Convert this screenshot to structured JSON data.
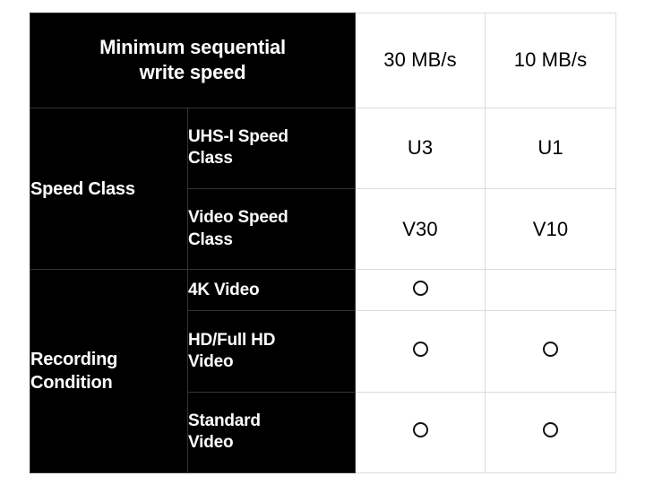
{
  "table": {
    "header": {
      "title": "Minimum sequential\nwrite speed",
      "title_line1": "Minimum sequential",
      "title_line2": "write speed",
      "columns": [
        "30 MB/s",
        "10 MB/s"
      ]
    },
    "groups": [
      {
        "label": "Speed Class",
        "rows": [
          {
            "label_line1": "UHS-I Speed",
            "label_line2": "Class",
            "values": [
              "U3",
              "U1"
            ],
            "value_kind": "text"
          },
          {
            "label_line1": "Video Speed",
            "label_line2": "Class",
            "values": [
              "V30",
              "V10"
            ],
            "value_kind": "text"
          }
        ]
      },
      {
        "label_line1": "Recording",
        "label_line2": "Condition",
        "label": "Recording Condition",
        "rows": [
          {
            "label_line1": "4K Video",
            "label_line2": "",
            "values": [
              "supported",
              "none"
            ],
            "value_kind": "mark"
          },
          {
            "label_line1": "HD/Full HD",
            "label_line2": "Video",
            "values": [
              "supported",
              "supported"
            ],
            "value_kind": "mark"
          },
          {
            "label_line1": "Standard",
            "label_line2": "Video",
            "values": [
              "supported",
              "supported"
            ],
            "value_kind": "mark"
          }
        ]
      }
    ],
    "mark_glyph": "circle-outline-icon",
    "colors": {
      "label_background": "#000000",
      "label_text": "#ffffff",
      "value_background": "#ffffff",
      "value_text": "#000000",
      "grid_light": "#dcdcdc",
      "grid_dark": "#333333"
    }
  }
}
